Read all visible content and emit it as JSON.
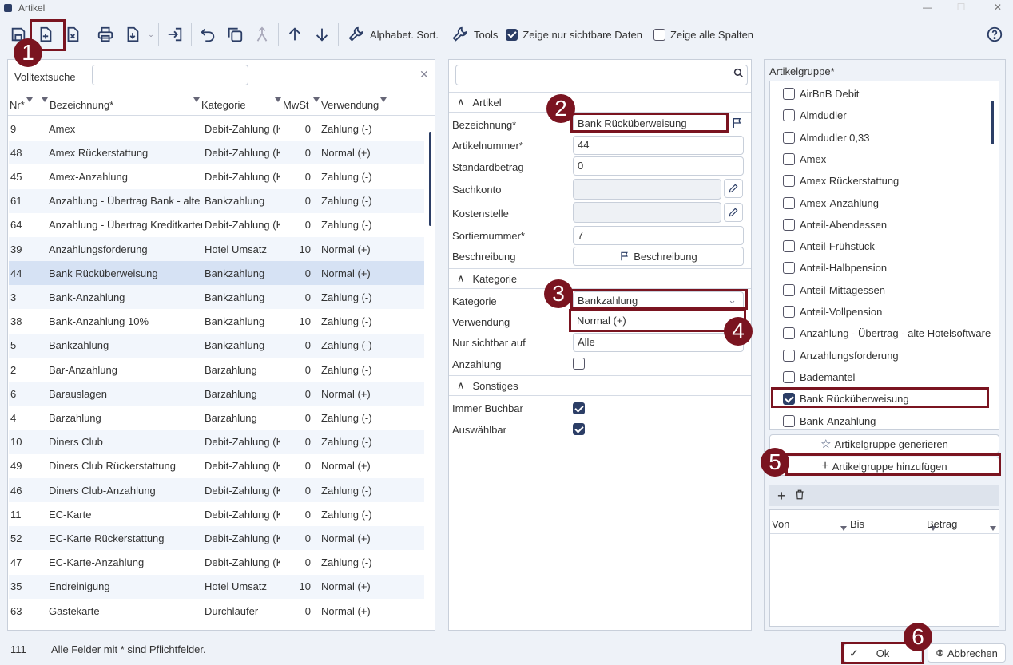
{
  "window": {
    "title": "Artikel"
  },
  "toolbar": {
    "sort_label": "Alphabet. Sort.",
    "tools_label": "Tools",
    "visible_only_label": "Zeige nur sichtbare Daten",
    "all_columns_label": "Zeige alle Spalten"
  },
  "search": {
    "label": "Volltextsuche",
    "value": ""
  },
  "table": {
    "headers": [
      "Nr*",
      "Bezeichnung*",
      "Kategorie",
      "MwSt",
      "Verwendung"
    ],
    "rows": [
      [
        "9",
        "Amex",
        "Debit-Zahlung (K",
        "0",
        "Zahlung (-)"
      ],
      [
        "48",
        "Amex Rückerstattung",
        "Debit-Zahlung (K",
        "0",
        "Normal (+)"
      ],
      [
        "45",
        "Amex-Anzahlung",
        "Debit-Zahlung (K",
        "0",
        "Zahlung (-)"
      ],
      [
        "61",
        "Anzahlung - Übertrag Bank - alte H",
        "Bankzahlung",
        "0",
        "Zahlung (-)"
      ],
      [
        "64",
        "Anzahlung - Übertrag Kreditkarten",
        "Debit-Zahlung (K",
        "0",
        "Zahlung (-)"
      ],
      [
        "39",
        "Anzahlungsforderung",
        "Hotel Umsatz",
        "10",
        "Normal (+)"
      ],
      [
        "44",
        "Bank Rücküberweisung",
        "Bankzahlung",
        "0",
        "Normal (+)"
      ],
      [
        "3",
        "Bank-Anzahlung",
        "Bankzahlung",
        "0",
        "Zahlung (-)"
      ],
      [
        "38",
        "Bank-Anzahlung 10%",
        "Bankzahlung",
        "10",
        "Zahlung (-)"
      ],
      [
        "5",
        "Bankzahlung",
        "Bankzahlung",
        "0",
        "Zahlung (-)"
      ],
      [
        "2",
        "Bar-Anzahlung",
        "Barzahlung",
        "0",
        "Zahlung (-)"
      ],
      [
        "6",
        "Barauslagen",
        "Barzahlung",
        "0",
        "Normal (+)"
      ],
      [
        "4",
        "Barzahlung",
        "Barzahlung",
        "0",
        "Zahlung (-)"
      ],
      [
        "10",
        "Diners Club",
        "Debit-Zahlung (K",
        "0",
        "Zahlung (-)"
      ],
      [
        "49",
        "Diners Club Rückerstattung",
        "Debit-Zahlung (K",
        "0",
        "Normal (+)"
      ],
      [
        "46",
        "Diners Club-Anzahlung",
        "Debit-Zahlung (K",
        "0",
        "Zahlung (-)"
      ],
      [
        "11",
        "EC-Karte",
        "Debit-Zahlung (K",
        "0",
        "Zahlung (-)"
      ],
      [
        "52",
        "EC-Karte Rückerstattung",
        "Debit-Zahlung (K",
        "0",
        "Normal (+)"
      ],
      [
        "47",
        "EC-Karte-Anzahlung",
        "Debit-Zahlung (K",
        "0",
        "Zahlung (-)"
      ],
      [
        "35",
        "Endreinigung",
        "Hotel Umsatz",
        "10",
        "Normal (+)"
      ],
      [
        "63",
        "Gästekarte",
        "Durchläufer",
        "0",
        "Normal (+)"
      ]
    ],
    "selected_nr": "44"
  },
  "form": {
    "section_artikel": "Artikel",
    "bezeichnung_label": "Bezeichnung*",
    "bezeichnung": "Bank Rücküberweisung",
    "artikelnummer_label": "Artikelnummer*",
    "artikelnummer": "44",
    "standardbetrag_label": "Standardbetrag",
    "standardbetrag": "0",
    "sachkonto_label": "Sachkonto",
    "sachkonto": "",
    "kostenstelle_label": "Kostenstelle",
    "kostenstelle": "",
    "sortiernummer_label": "Sortiernummer*",
    "sortiernummer": "7",
    "beschreibung_label": "Beschreibung",
    "beschreibung_button": "Beschreibung",
    "section_kategorie": "Kategorie",
    "kategorie_label": "Kategorie",
    "kategorie": "Bankzahlung",
    "verwendung_label": "Verwendung",
    "verwendung": "Normal (+)",
    "nur_sichtbar_label": "Nur sichtbar auf",
    "nur_sichtbar": "Alle",
    "anzahlung_label": "Anzahlung",
    "anzahlung": false,
    "section_sonstiges": "Sonstiges",
    "immer_buchbar_label": "Immer Buchbar",
    "immer_buchbar": true,
    "auswaehlbar_label": "Auswählbar",
    "auswaehlbar": true
  },
  "artikelgruppe": {
    "title": "Artikelgruppe*",
    "items": [
      {
        "label": "AirBnB Debit",
        "checked": false
      },
      {
        "label": "Almdudler",
        "checked": false
      },
      {
        "label": "Almdudler 0,33",
        "checked": false
      },
      {
        "label": "Amex",
        "checked": false
      },
      {
        "label": "Amex Rückerstattung",
        "checked": false
      },
      {
        "label": "Amex-Anzahlung",
        "checked": false
      },
      {
        "label": "Anteil-Abendessen",
        "checked": false
      },
      {
        "label": "Anteil-Frühstück",
        "checked": false
      },
      {
        "label": "Anteil-Halbpension",
        "checked": false
      },
      {
        "label": "Anteil-Mittagessen",
        "checked": false
      },
      {
        "label": "Anteil-Vollpension",
        "checked": false
      },
      {
        "label": "Anzahlung - Übertrag - alte Hotelsoftware",
        "checked": false
      },
      {
        "label": "Anzahlungsforderung",
        "checked": false
      },
      {
        "label": "Bademantel",
        "checked": false
      },
      {
        "label": "Bank Rücküberweisung",
        "checked": true
      },
      {
        "label": "Bank-Anzahlung",
        "checked": false
      }
    ],
    "generate_label": "Artikelgruppe generieren",
    "add_label": "Artikelgruppe hinzufügen",
    "sub_headers": [
      "Von",
      "Bis",
      "Betrag"
    ]
  },
  "footer": {
    "count": "111",
    "hint": "Alle Felder mit * sind Pflichtfelder.",
    "ok_label": "Ok",
    "cancel_label": "Abbrechen"
  },
  "markers": [
    "1",
    "2",
    "3",
    "4",
    "5",
    "6"
  ],
  "colors": {
    "accent": "#2c3e66",
    "marker": "#7a1420",
    "selection": "#d6e2f4"
  }
}
